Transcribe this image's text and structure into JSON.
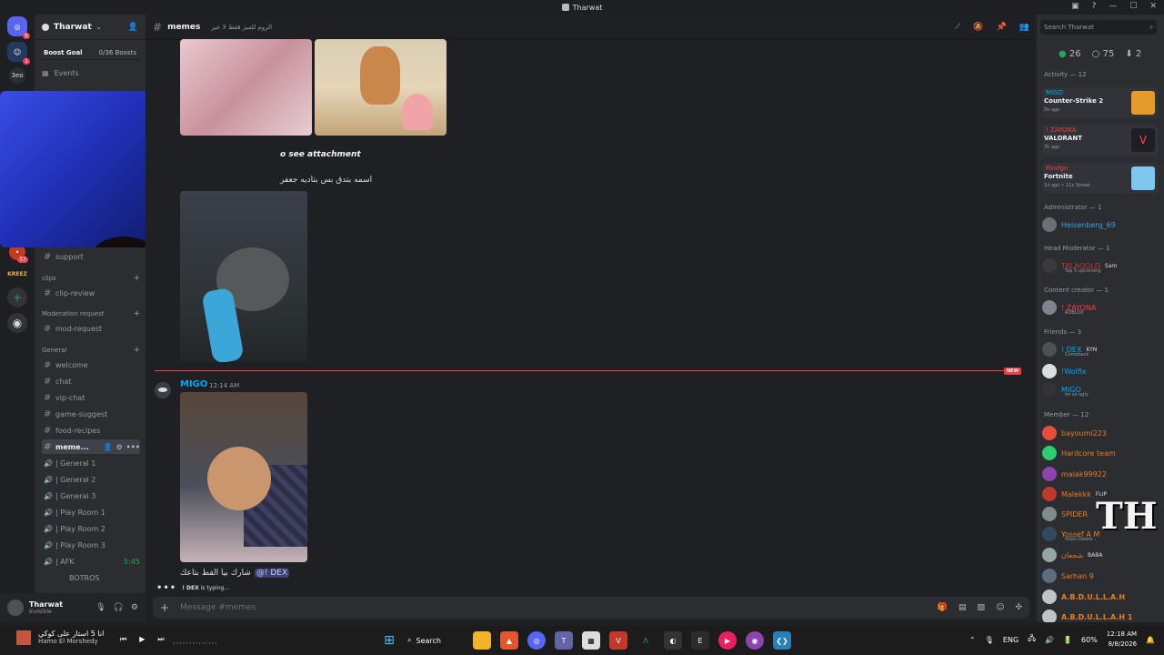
{
  "window": {
    "title": "Tharwat"
  },
  "guilds": {
    "items": [
      {
        "name": "discord-home-icon",
        "badge": "6"
      },
      {
        "name": "server-dm",
        "badge": "1"
      },
      {
        "name": "server-3eo",
        "label": "3eo"
      },
      {
        "name": "server-c1",
        "badge": ""
      },
      {
        "name": "server-kreez",
        "label": "KREEZ"
      }
    ],
    "unread_count_57": "57"
  },
  "server": {
    "name": "Tharwat",
    "boost_goal": "Boost Goal",
    "boost_count": "0/36 Boosts",
    "events": "Events"
  },
  "channels": {
    "support": "support",
    "cat_clips": "clips",
    "clip_review": "clip-review",
    "cat_moderation": "Moderation request",
    "mod_request": "mod-request",
    "cat_general": "General",
    "welcome": "welcome",
    "chat": "chat",
    "vip_chat": "vip-chat",
    "game_suggest": "game-suggest",
    "food_recipes": "food-recipes",
    "memes": "meme...",
    "voice": [
      "| General 1",
      "| General 2",
      "| General 3",
      "| Play Room 1",
      "| Play Room 2",
      "| Play Room 3",
      "| AFK"
    ],
    "afk_time": "5:45",
    "botros": "BOTROS"
  },
  "chat": {
    "channel": "memes",
    "topic": "الروم للميز فقط لا عير",
    "attach_text": "o see attachment",
    "arabic_msg": "اسمه بتدق بس بتاديه  جعفر",
    "author": "MIGO",
    "time": "12:14 AM",
    "new_badge": "NEW",
    "msg_text": "شارك بيا القط بتاعك",
    "mention": "@! DEX",
    "typing_user": "! DEX",
    "typing_text": "is typing...",
    "placeholder": "Message #memes"
  },
  "members": {
    "search_placeholder": "Search Tharwat",
    "online": "26",
    "idle": "75",
    "other": "2",
    "activity_title": "Activity — 12",
    "activities": [
      {
        "user": "MIGO",
        "game": "Counter-Strike 2",
        "ago": "5h ago"
      },
      {
        "user": "! ZAYONA",
        "game": "VALORANT",
        "ago": "7h ago"
      },
      {
        "user": "Rkafgo",
        "game": "Fortnite",
        "ago": "1d ago",
        "streak": "11x Streak"
      }
    ],
    "admin_title": "Administrator — 1",
    "admin": "Heisenberg_69",
    "headmod_title": "Head Moderator — 1",
    "headmod": "TALAQOLD",
    "headmod_tag": "Sam",
    "headmod_sub": "Top 5 upcoming",
    "creator_title": "Content creator — 1",
    "creator": "! ZAYONA",
    "creator_sub": "ROBLOX",
    "friends_title": "Friends — 3",
    "friends": [
      {
        "name": "! DEX",
        "tag": "KYN",
        "sub": "Comeback"
      },
      {
        "name": "!Wolfix",
        "tag": "",
        "sub": ""
      },
      {
        "name": "MIGO",
        "tag": "",
        "sub": "im so ugly"
      }
    ],
    "member_title": "Member — 12",
    "member_list": [
      {
        "name": "bayoumi223",
        "tag": "",
        "sub": ""
      },
      {
        "name": "Hardcore team",
        "tag": "",
        "sub": ""
      },
      {
        "name": "malak99922",
        "tag": "",
        "sub": ""
      },
      {
        "name": "Malekkk",
        "tag": "FLIP",
        "sub": ""
      },
      {
        "name": "SPIDER",
        "tag": "",
        "sub": ""
      },
      {
        "name": "Yossef A M",
        "tag": "",
        "sub": "https://www..."
      },
      {
        "name": "شجعان",
        "tag": "BABA",
        "sub": ""
      },
      {
        "name": "Sarhan 9",
        "tag": "",
        "sub": ""
      },
      {
        "name": "A.B.D.U.L.L.A.H",
        "tag": "",
        "sub": ""
      },
      {
        "name": "A.B.D.U.L.L.A.H 1",
        "tag": "",
        "sub": ""
      }
    ]
  },
  "user": {
    "name": "Tharwat",
    "status": "Invisible"
  },
  "taskbar": {
    "song": "انا 5 استار على كوكي",
    "artist": "Hamo El Morshedy",
    "search": "Search",
    "lang": "ENG",
    "battery": "60%",
    "time": "12:18 AM",
    "date": "8/8/2026"
  },
  "colors": {
    "accent": "#5865f2",
    "mention": "#00a8fc",
    "danger": "#f23f43",
    "online": "#23a55a"
  }
}
